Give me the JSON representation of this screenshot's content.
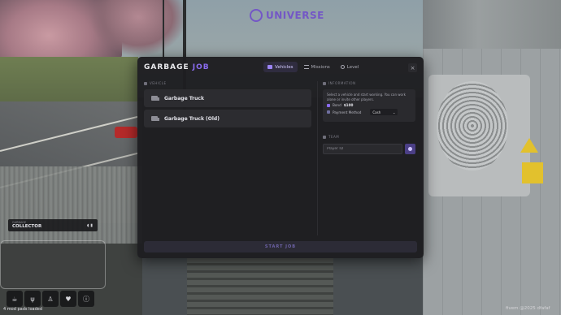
{
  "logo": {
    "text": "UNIVERSE"
  },
  "dialog": {
    "title_main": "GARBAGE",
    "title_accent": "JOB",
    "tabs": [
      {
        "label": "Vehicles",
        "icon": "truck-icon",
        "active": true
      },
      {
        "label": "Missions",
        "icon": "list-icon",
        "active": false
      },
      {
        "label": "Level",
        "icon": "level-icon",
        "active": false
      }
    ],
    "close_label": "×",
    "vehicle_section_label": "VEHICLE",
    "vehicles": [
      {
        "name": "Garbage Truck"
      },
      {
        "name": "Garbage Truck (Old)"
      }
    ],
    "info_section_label": "INFORMATION",
    "info_text": "Select a vehicle and start working. You can work alone or invite other players.",
    "reward_label": "Bond",
    "reward_value": "$100",
    "payment_label": "Payment Method",
    "payment_value": "Cash",
    "team_section_label": "TEAM",
    "player_placeholder": "Player ID",
    "start_label": "START JOB"
  },
  "hud": {
    "job_small": "GARBAGE",
    "job_name": "COLLECTOR",
    "status_text": "4 mod pads loaded",
    "icons": [
      "coffee-icon",
      "food-icon",
      "walk-icon",
      "heart-icon",
      "info-icon"
    ]
  },
  "watermark": "fivem @2025 dfafaf"
}
